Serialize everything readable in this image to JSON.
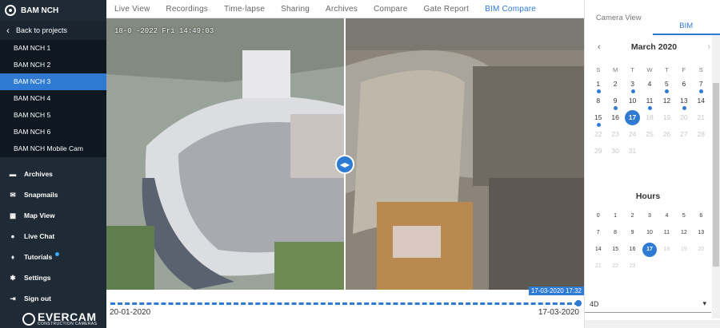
{
  "sidebar": {
    "brand": "BAM NCH",
    "back_label": "Back to projects",
    "cameras": [
      "BAM NCH 1",
      "BAM NCH 2",
      "BAM NCH 3",
      "BAM NCH 4",
      "BAM NCH 5",
      "BAM NCH 6",
      "BAM NCH Mobile Cam"
    ],
    "active_camera": "BAM NCH 3",
    "nav": [
      {
        "label": "Archives",
        "icon": "archive-icon"
      },
      {
        "label": "Snapmails",
        "icon": "mail-icon"
      },
      {
        "label": "Map View",
        "icon": "map-icon"
      },
      {
        "label": "Live Chat",
        "icon": "chat-icon"
      },
      {
        "label": "Tutorials",
        "icon": "lightbulb-icon"
      },
      {
        "label": "Settings",
        "icon": "gear-icon"
      },
      {
        "label": "Sign out",
        "icon": "sign-out-icon"
      }
    ],
    "logo_name": "EVERCAM",
    "logo_sub": "CONSTRUCTION CAMERAS"
  },
  "tabs": [
    "Live View",
    "Recordings",
    "Time-lapse",
    "Sharing",
    "Archives",
    "Compare",
    "Gate Report",
    "BIM Compare"
  ],
  "active_tab": "BIM Compare",
  "viewer": {
    "timestamp": "18-0 -2022 Fri 14:49:03"
  },
  "timeline": {
    "start": "20-01-2020",
    "end": "17-03-2020",
    "current": "17-03-2020 17:32"
  },
  "panel": {
    "tab_camera": "Camera View",
    "tab_bim": "BIM",
    "month": "March 2020",
    "day_headers": [
      "S",
      "M",
      "T",
      "W",
      "T",
      "F",
      "S"
    ],
    "days": [
      {
        "d": "1",
        "mk": true
      },
      {
        "d": "2"
      },
      {
        "d": "3",
        "mk": true
      },
      {
        "d": "4"
      },
      {
        "d": "5",
        "mk": true
      },
      {
        "d": "6"
      },
      {
        "d": "7",
        "mk": true
      },
      {
        "d": "8"
      },
      {
        "d": "9",
        "mk": true
      },
      {
        "d": "10"
      },
      {
        "d": "11",
        "mk": true
      },
      {
        "d": "12"
      },
      {
        "d": "13",
        "mk": true
      },
      {
        "d": "14"
      },
      {
        "d": "15",
        "mk": true
      },
      {
        "d": "16"
      },
      {
        "d": "17",
        "sel": true
      },
      {
        "d": "18",
        "dim": true
      },
      {
        "d": "19",
        "dim": true
      },
      {
        "d": "20",
        "dim": true
      },
      {
        "d": "21",
        "dim": true
      },
      {
        "d": "22",
        "dim": true
      },
      {
        "d": "23",
        "dim": true
      },
      {
        "d": "24",
        "dim": true
      },
      {
        "d": "25",
        "dim": true
      },
      {
        "d": "26",
        "dim": true
      },
      {
        "d": "27",
        "dim": true
      },
      {
        "d": "28",
        "dim": true
      },
      {
        "d": "29",
        "dim": true
      },
      {
        "d": "30",
        "dim": true
      },
      {
        "d": "31",
        "dim": true
      }
    ],
    "hours_title": "Hours",
    "hours": [
      {
        "h": "0"
      },
      {
        "h": "1"
      },
      {
        "h": "2"
      },
      {
        "h": "3"
      },
      {
        "h": "4"
      },
      {
        "h": "5"
      },
      {
        "h": "6"
      },
      {
        "h": "7"
      },
      {
        "h": "8"
      },
      {
        "h": "9"
      },
      {
        "h": "10"
      },
      {
        "h": "11"
      },
      {
        "h": "12"
      },
      {
        "h": "13"
      },
      {
        "h": "14"
      },
      {
        "h": "15"
      },
      {
        "h": "16"
      },
      {
        "h": "17",
        "sel": true
      },
      {
        "h": "18",
        "dim": true
      },
      {
        "h": "19",
        "dim": true
      },
      {
        "h": "20",
        "dim": true
      },
      {
        "h": "21",
        "dim": true
      },
      {
        "h": "22",
        "dim": true
      },
      {
        "h": "23",
        "dim": true
      }
    ],
    "model_select": "4D"
  },
  "colors": {
    "accent": "#2f7bd4",
    "sidebar_bg": "#1e2a36"
  }
}
